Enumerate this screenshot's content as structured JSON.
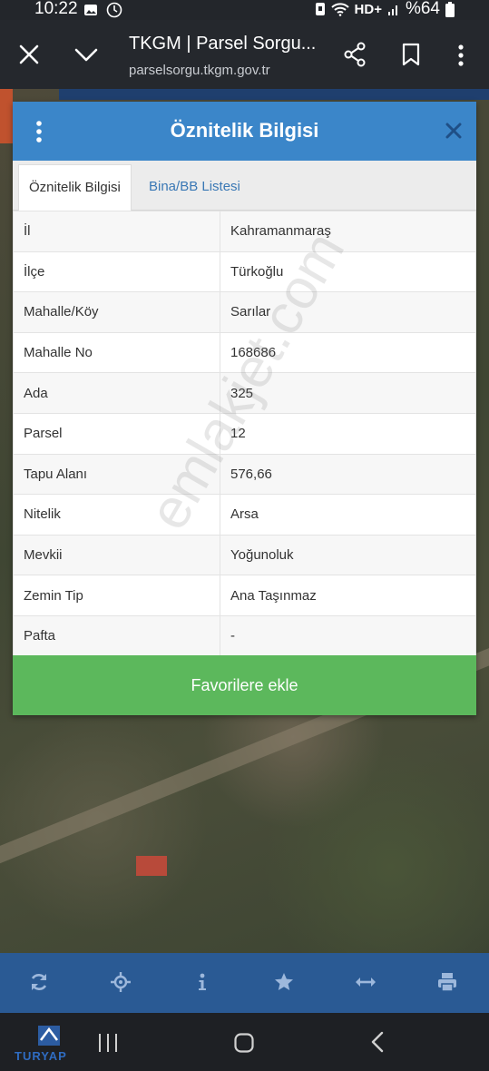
{
  "status_bar": {
    "time": "10:22",
    "battery": "%64",
    "network": "HD+"
  },
  "browser": {
    "title": "TKGM | Parsel Sorgu...",
    "url": "parselsorgu.tkgm.gov.tr"
  },
  "dialog": {
    "title": "Öznitelik Bilgisi",
    "tabs": [
      {
        "label": "Öznitelik Bilgisi",
        "active": true
      },
      {
        "label": "Bina/BB Listesi",
        "active": false
      }
    ],
    "rows": [
      {
        "key": "İl",
        "value": "Kahramanmaraş"
      },
      {
        "key": "İlçe",
        "value": "Türkoğlu"
      },
      {
        "key": "Mahalle/Köy",
        "value": "Sarılar"
      },
      {
        "key": "Mahalle No",
        "value": "168686"
      },
      {
        "key": "Ada",
        "value": "325"
      },
      {
        "key": "Parsel",
        "value": "12"
      },
      {
        "key": "Tapu Alanı",
        "value": "576,66"
      },
      {
        "key": "Nitelik",
        "value": "Arsa"
      },
      {
        "key": "Mevkii",
        "value": "Yoğunoluk"
      },
      {
        "key": "Zemin Tip",
        "value": "Ana Taşınmaz"
      },
      {
        "key": "Pafta",
        "value": "-"
      }
    ],
    "favorite_button": "Favorilere ekle"
  },
  "watermark": "emlakjet.com",
  "logo": "TURYAP",
  "colors": {
    "header_blue": "#3b86c9",
    "favorite_green": "#5cb85c",
    "toolbar_blue": "#2a5a94"
  },
  "toolbar_icons": [
    "refresh-icon",
    "locate-icon",
    "info-icon",
    "star-icon",
    "measure-icon",
    "print-icon"
  ]
}
